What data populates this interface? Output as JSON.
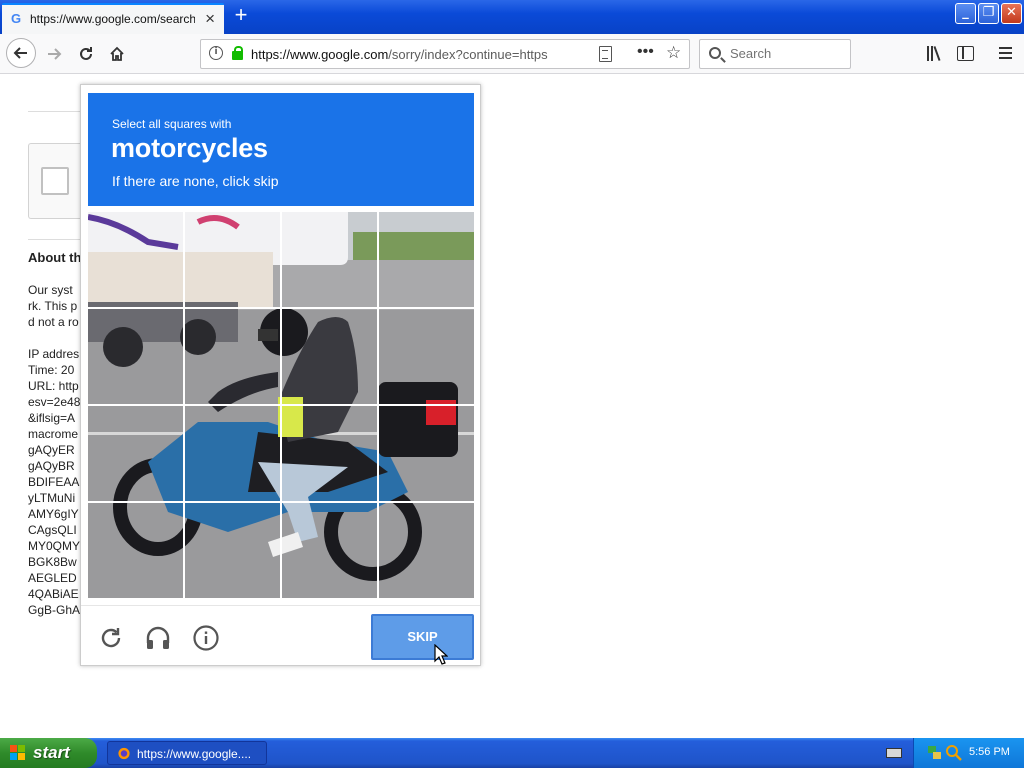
{
  "browser": {
    "tab_title": "https://www.google.com/search?",
    "tab_close": "×",
    "new_tab": "+",
    "url_host": "https://www.google.com",
    "url_path": "/sorry/index?continue=https",
    "search_placeholder": "Search",
    "window_buttons": {
      "minimize": "_",
      "restore": "❐",
      "close": "✕"
    }
  },
  "page": {
    "about_title": "About this page",
    "about_lines": "Our syst\nrk. This p\nd not a ro\n\nIP addres\nTime: 20\nURL: http\nesv=2e48\n&iflsig=A\nmacrome\ngAQyER\ngAQyBR\nBDIFEAA\nyLTMuNi\nAMY6gIY\nCAgsQLI\nMY0QMY\nBGK8Bw\nAEGLED\n4QABiAE\nGgB-GhA"
  },
  "captcha": {
    "instruction": "Select all squares with",
    "target": "motorcycles",
    "hint": "If there are none, click skip",
    "grid_rows": 4,
    "grid_cols": 4,
    "skip_label": "SKIP",
    "footer_icons": [
      "reload-icon",
      "headphones-icon",
      "info-icon"
    ]
  },
  "taskbar": {
    "start_label": "start",
    "task_label": "https://www.google....",
    "clock": "5:56 PM"
  },
  "colors": {
    "captcha_header": "#1a73e8",
    "skip_button": "#5e9ce8",
    "taskbar": "#245edb",
    "start_button": "#3c9a36"
  }
}
